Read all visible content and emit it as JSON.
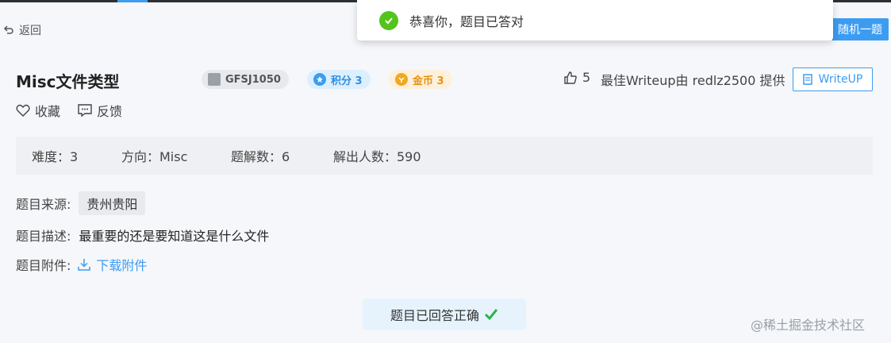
{
  "header": {
    "back_label": "返回",
    "random_button": "随机一题"
  },
  "toast": {
    "message": "恭喜你，题目已答对"
  },
  "challenge": {
    "title": "Misc文件类型",
    "tags": {
      "id": "GFSJ1050",
      "score": "积分 3",
      "gold": "金币 3"
    },
    "likes": "5",
    "best_writeup": "最佳Writeup由 redlz2500 提供",
    "writeup_button": "WriteUP",
    "favorite_label": "收藏",
    "feedback_label": "反馈",
    "stats": {
      "difficulty": "难度：3",
      "direction": "方向：Misc",
      "writeups": "题解数：6",
      "solvers": "解出人数：590"
    },
    "source_label": "题目来源:",
    "source_value": "贵州贵阳",
    "desc_label": "题目描述:",
    "desc_value": "最重要的还是要知道这是什么文件",
    "attach_label": "题目附件:",
    "attach_value": "下载附件",
    "status": "题目已回答正确"
  },
  "watermark": "@稀土掘金技术社区",
  "colors": {
    "accent": "#3b9cf2",
    "success": "#52c41a",
    "gold": "#e8920f"
  }
}
